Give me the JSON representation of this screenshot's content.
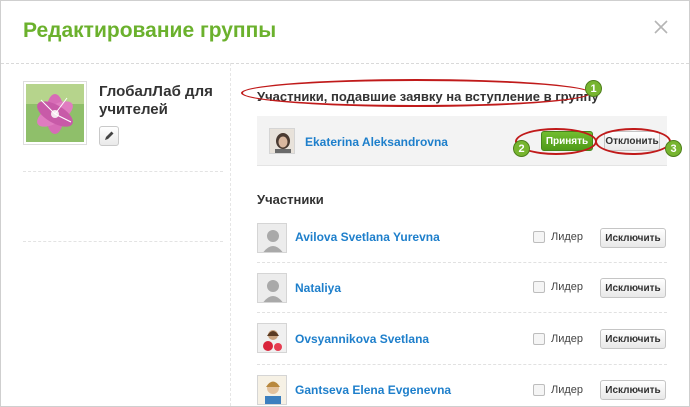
{
  "dialog": {
    "title": "Редактирование группы",
    "close_icon": "close-icon"
  },
  "group": {
    "name": "ГлобалЛаб для учителей",
    "photo_icon": "flower-photo",
    "edit_icon": "pencil-icon"
  },
  "requests": {
    "title": "Участники, подавшие заявку на вступление в группу",
    "items": [
      {
        "name": "Ekaterina Aleksandrovna",
        "accept_label": "Принять",
        "decline_label": "Отклонить"
      }
    ]
  },
  "members": {
    "title": "Участники",
    "leader_label": "Лидер",
    "exclude_label": "Исключить",
    "items": [
      {
        "name": "Avilova Svetlana Yurevna",
        "avatar": "default-avatar"
      },
      {
        "name": "Nataliya",
        "avatar": "default-avatar"
      },
      {
        "name": "Ovsyannikova Svetlana",
        "avatar": "photo-avatar"
      },
      {
        "name": "Gantseva Elena Evgenevna",
        "avatar": "photo-avatar"
      }
    ]
  },
  "annotations": {
    "badge_1": "1",
    "badge_2": "2",
    "badge_3": "3",
    "highlight_color": "#c01a1a",
    "badge_color": "#77b52f"
  },
  "colors": {
    "accent": "#6bb12d",
    "link": "#1e7fcb"
  }
}
